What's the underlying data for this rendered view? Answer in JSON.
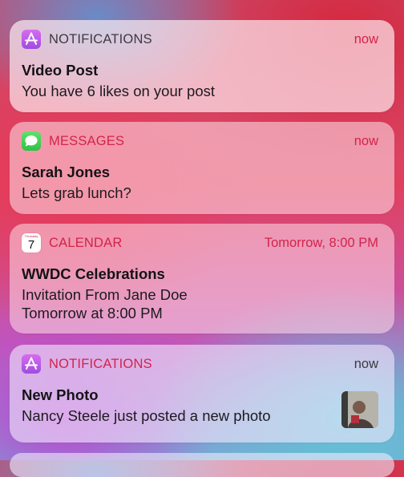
{
  "notifications": [
    {
      "app": "NOTIFICATIONS",
      "icon": "app-store-icon",
      "time": "now",
      "title": "Video Post",
      "lines": [
        "You have 6 likes on your post"
      ]
    },
    {
      "app": "MESSAGES",
      "icon": "messages-icon",
      "time": "now",
      "title": "Sarah Jones",
      "lines": [
        "Lets grab lunch?"
      ]
    },
    {
      "app": "CALENDAR",
      "icon": "calendar-icon",
      "icon_day_label": "Thursday",
      "icon_day": "7",
      "time": "Tomorrow, 8:00 PM",
      "title": "WWDC Celebrations",
      "lines": [
        "Invitation From Jane Doe",
        "Tomorrow at 8:00 PM"
      ]
    },
    {
      "app": "NOTIFICATIONS",
      "icon": "app-store-icon",
      "time": "now",
      "title": "New Photo",
      "lines": [
        "Nancy Steele just posted a new photo"
      ],
      "attachment": "photo-thumbnail"
    }
  ],
  "colors": {
    "accent_red": "#d3234a",
    "app_store_icon": "#b957e8",
    "messages_icon": "#3ed356",
    "secondary_text": "#3d3940"
  }
}
